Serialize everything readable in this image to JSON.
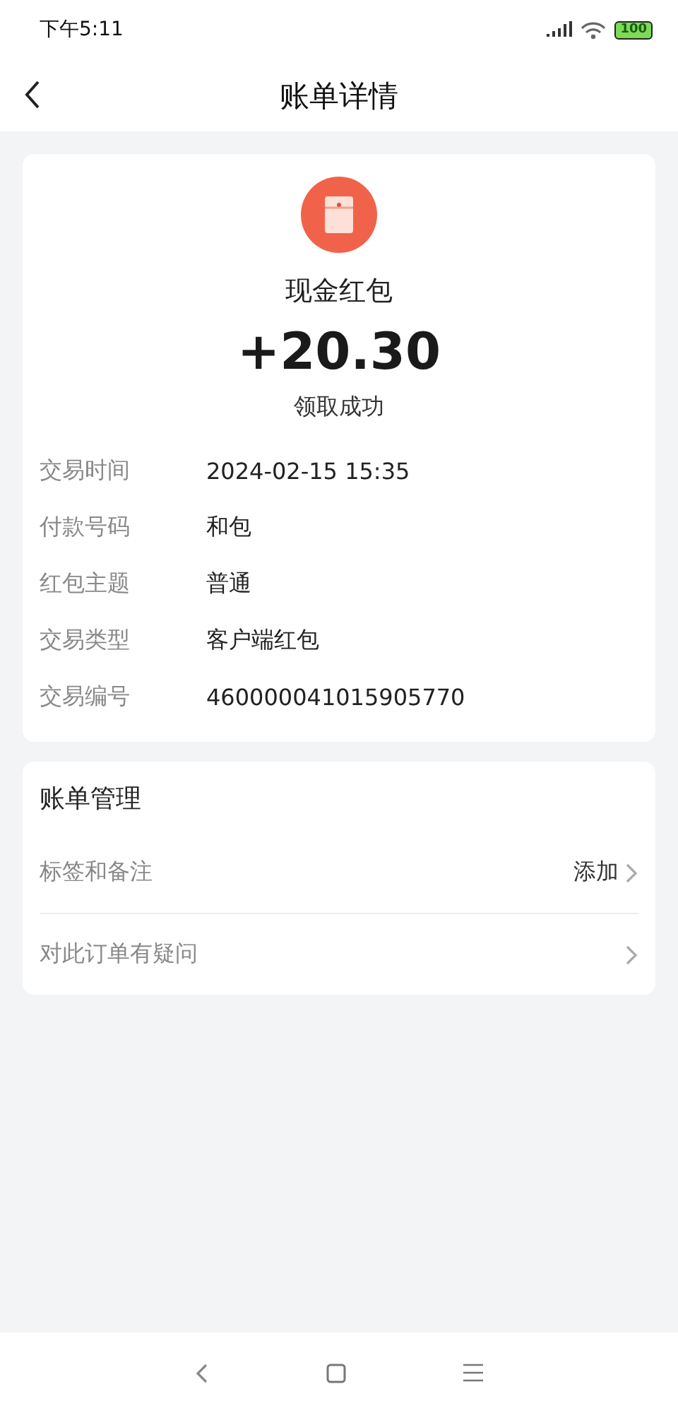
{
  "status_bar": {
    "time": "下午5:11",
    "battery": "100"
  },
  "header": {
    "title": "账单详情"
  },
  "summary": {
    "name": "现金红包",
    "amount": "+20.30",
    "status": "领取成功"
  },
  "details": [
    {
      "label": "交易时间",
      "value": "2024-02-15 15:35"
    },
    {
      "label": "付款号码",
      "value": "和包"
    },
    {
      "label": "红包主题",
      "value": "普通"
    },
    {
      "label": "交易类型",
      "value": "客户端红包"
    },
    {
      "label": "交易编号",
      "value": "460000041015905770"
    }
  ],
  "management": {
    "title": "账单管理",
    "items": [
      {
        "label": "标签和备注",
        "action": "添加"
      },
      {
        "label": "对此订单有疑问"
      }
    ]
  }
}
